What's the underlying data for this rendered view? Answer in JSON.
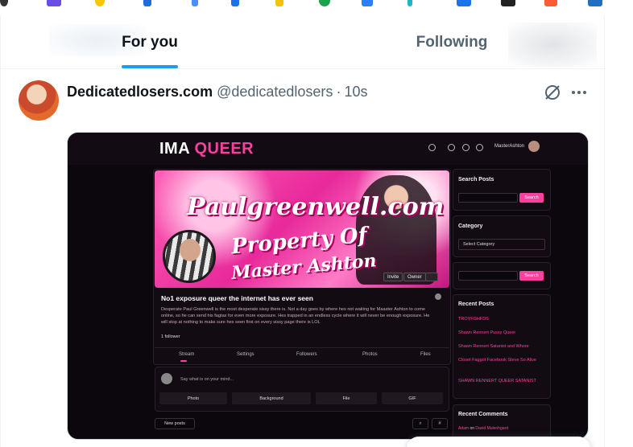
{
  "colors": {
    "accent": "#1d9bf0",
    "text_primary": "#0f1419",
    "text_secondary": "#536471",
    "media_pink": "#ff3f9e"
  },
  "browser_strip": {
    "icons": [
      "app-icon-1",
      "app-icon-2",
      "app-icon-3",
      "app-icon-4",
      "app-icon-5",
      "app-icon-6",
      "app-icon-7",
      "app-icon-8",
      "app-icon-9",
      "app-icon-10",
      "app-icon-11",
      "app-icon-12",
      "app-icon-13"
    ]
  },
  "tabs": {
    "for_you": "For you",
    "following": "Following"
  },
  "post": {
    "display_name": "Dedicatedlosers.com",
    "handle": "@dedicatedlosers",
    "separator": "·",
    "time": "10s",
    "more": "···"
  },
  "media": {
    "logo_white": "IMA",
    "logo_pink": "QUEER",
    "username": "MasterAshton",
    "banner_line1": "Paulgreenwell.com",
    "banner_line2": "Property Of",
    "banner_line3": "Master Ashton",
    "invite_btn": "Invite",
    "owner_btn": "Owner",
    "group_title": "No1 exposure queer the internet has ever seen",
    "group_desc": "Desperate Paul Greenwell is the most desperate sissy there is. Not a day goes by where hes not waiting for Maaster Ashton to come online, so he can send his fagtax for even more exposure. Hes trapped in an endless cycle where it will never be enough exposure. He will stop at nothing to make sure hes seen first on every sissy page there is LOL",
    "followers": "1 follower",
    "tabs": [
      "Stream",
      "Settings",
      "Followers",
      "Photos",
      "Files"
    ],
    "composer_placeholder": "Say what is on your mind...",
    "composer_buttons": [
      "Photo",
      "Background",
      "File",
      "GIF"
    ],
    "new_posts": "New posts",
    "sidebar": {
      "search_posts_title": "Search Posts",
      "search_btn": "Search",
      "category_title": "Category",
      "category_select": "Select Category",
      "search_btn_2": "Search",
      "recent_posts_title": "Recent Posts",
      "recent_posts": [
        "TROYFGHFDS",
        "Shawn Rennert Pussy Queer",
        "Shawn Rennert Satanist and Whore",
        "Closet Faggot Facebook Steve So Alive",
        "SHAWN RENNERT QUEER SATANIST"
      ],
      "recent_comments_title": "Recent Comments",
      "recent_comment_author": "Adam",
      "recent_comment_on": "on",
      "recent_comment_target": "David Mulenhgard"
    }
  }
}
